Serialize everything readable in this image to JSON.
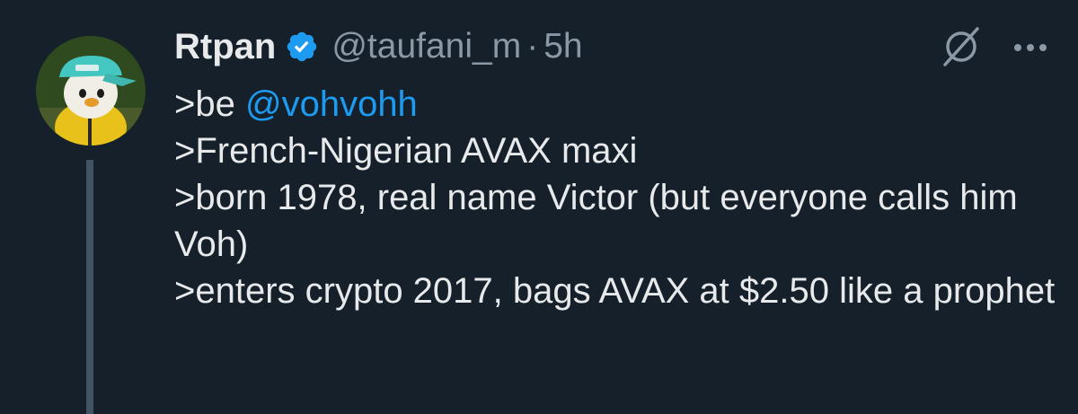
{
  "tweet": {
    "author": {
      "display_name": "Rtpan",
      "handle": "@taufani_m",
      "verified_icon": "verified-badge-icon",
      "avatar": "penguin-with-cap-avatar"
    },
    "separator": "·",
    "timestamp": "5h",
    "actions": {
      "grok_icon": "grok-slash-icon",
      "more_icon": "more-dots-icon"
    },
    "lines": {
      "l1_prefix": ">be ",
      "l1_mention": "@vohvohh",
      "l2": ">French-Nigerian AVAX maxi",
      "l3": ">born 1978, real name Victor (but everyone calls him Voh)",
      "l4": ">enters crypto 2017, bags AVAX at $2.50 like a prophet"
    }
  },
  "colors": {
    "background": "#15202b",
    "text": "#e7e9ea",
    "secondary": "#8b98a5",
    "accent": "#1d9bf0",
    "thread_line": "#425364"
  }
}
